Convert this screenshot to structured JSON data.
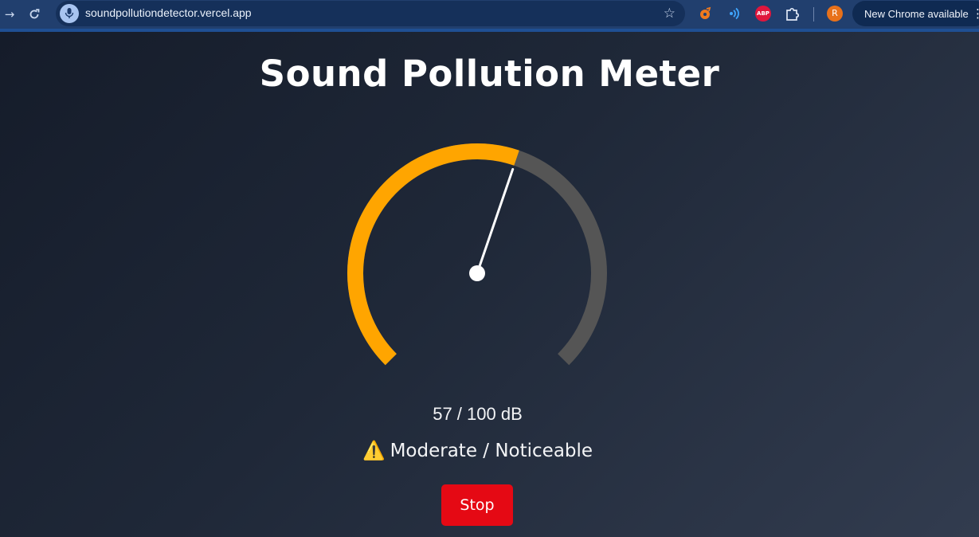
{
  "browser": {
    "url": "soundpollutiondetector.vercel.app",
    "update_label": "New Chrome available",
    "profile_initial": "R",
    "abp_label": "ABP",
    "icons": [
      "forward-icon",
      "reload-icon",
      "mic-icon",
      "star-icon",
      "extension-icon",
      "radio-icon",
      "adblock-icon",
      "puzzle-icon",
      "menu-icon"
    ]
  },
  "app": {
    "title": "Sound Pollution Meter",
    "reading_text": "57 / 100 dB",
    "status_icon": "⚠️",
    "status_text": "Moderate / Noticeable",
    "stop_label": "Stop"
  },
  "gauge": {
    "value": 57,
    "max": 100,
    "fill_color": "#FFA500",
    "track_color": "#555555",
    "needle_color": "#FFFFFF"
  },
  "colors": {
    "background": "#1E293B",
    "stop_button": "#E50914",
    "chrome_bar": "#213F6E"
  }
}
